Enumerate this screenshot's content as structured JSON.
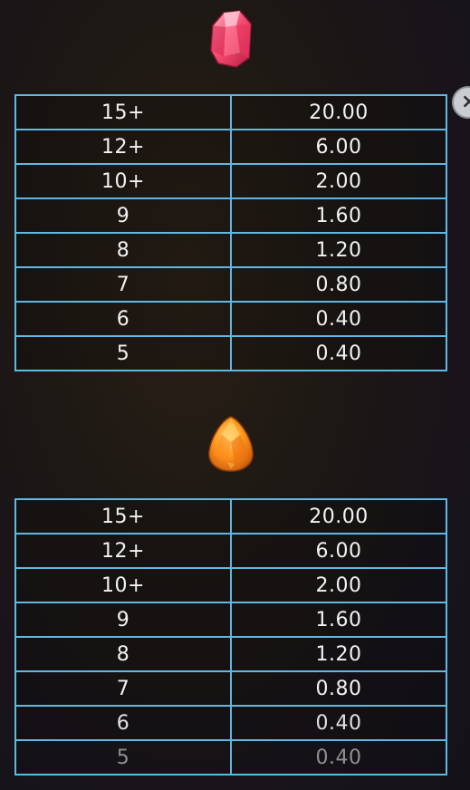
{
  "close_button": {
    "glyph": "×"
  },
  "paytables": [
    {
      "symbol_icon": "pink-crystal-icon",
      "rows": [
        {
          "count": "15+",
          "payout": "20.00"
        },
        {
          "count": "12+",
          "payout": "6.00"
        },
        {
          "count": "10+",
          "payout": "2.00"
        },
        {
          "count": "9",
          "payout": "1.60"
        },
        {
          "count": "8",
          "payout": "1.20"
        },
        {
          "count": "7",
          "payout": "0.80"
        },
        {
          "count": "6",
          "payout": "0.40"
        },
        {
          "count": "5",
          "payout": "0.40"
        }
      ]
    },
    {
      "symbol_icon": "orange-crystal-icon",
      "rows": [
        {
          "count": "15+",
          "payout": "20.00"
        },
        {
          "count": "12+",
          "payout": "6.00"
        },
        {
          "count": "10+",
          "payout": "2.00"
        },
        {
          "count": "9",
          "payout": "1.60"
        },
        {
          "count": "8",
          "payout": "1.20"
        },
        {
          "count": "7",
          "payout": "0.80"
        },
        {
          "count": "6",
          "payout": "0.40"
        },
        {
          "count": "5",
          "payout": "0.40"
        }
      ]
    }
  ],
  "colors": {
    "border": "#5fb9e3",
    "text": "#f2f2f2",
    "pink_gem": "#ff5a7a",
    "orange_gem": "#ff8a1a"
  }
}
